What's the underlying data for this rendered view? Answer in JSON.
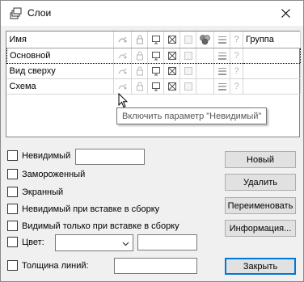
{
  "window": {
    "title": "Слои"
  },
  "grid": {
    "columns": [
      {
        "label": "Имя"
      },
      {
        "icon": "invisible-icon"
      },
      {
        "icon": "lock-icon"
      },
      {
        "icon": "screen-icon"
      },
      {
        "icon": "cross-box-icon"
      },
      {
        "icon": "empty-box-icon"
      },
      {
        "icon": "color-circles-icon"
      },
      {
        "icon": "line-weight-icon"
      },
      {
        "icon": "question-icon",
        "text": "?"
      },
      {
        "label": "Группа"
      }
    ],
    "rows": [
      {
        "name": "Основной",
        "selected": true
      },
      {
        "name": "Вид сверху",
        "selected": false
      },
      {
        "name": "Схема",
        "selected": false
      }
    ],
    "question": "?"
  },
  "tooltip": {
    "text": "Включить параметр \"Невидимый\""
  },
  "options": {
    "invisible": "Невидимый",
    "frozen": "Замороженный",
    "screen": "Экранный",
    "invisible_on_insert": "Невидимый при вставке в сборку",
    "visible_on_insert": "Видимый только при вставке в сборку",
    "color": "Цвет:",
    "line_weight": "Толщина линий:"
  },
  "buttons": {
    "new": "Новый",
    "delete": "Удалить",
    "rename": "Переименовать",
    "info": "Информация...",
    "close": "Закрыть"
  },
  "colors": {
    "accent": "#0078d7",
    "disabled_icon": "#b9b9b9"
  }
}
